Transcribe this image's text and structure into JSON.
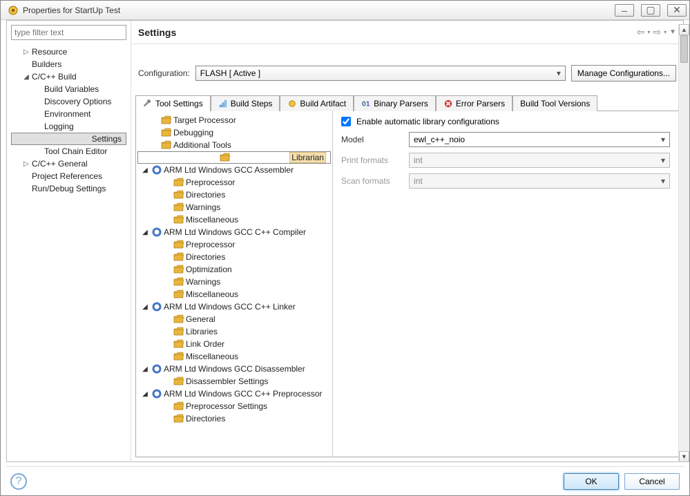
{
  "window": {
    "title": "Properties for StartUp Test"
  },
  "filter": {
    "placeholder": "type filter text"
  },
  "nav": {
    "items": [
      {
        "label": "Resource",
        "tw": "▷",
        "depth": 1
      },
      {
        "label": "Builders",
        "tw": "",
        "depth": 1
      },
      {
        "label": "C/C++ Build",
        "tw": "◢",
        "depth": 1
      },
      {
        "label": "Build Variables",
        "tw": "",
        "depth": 2
      },
      {
        "label": "Discovery Options",
        "tw": "",
        "depth": 2
      },
      {
        "label": "Environment",
        "tw": "",
        "depth": 2
      },
      {
        "label": "Logging",
        "tw": "",
        "depth": 2
      },
      {
        "label": "Settings",
        "tw": "",
        "depth": 2,
        "selected": true
      },
      {
        "label": "Tool Chain Editor",
        "tw": "",
        "depth": 2
      },
      {
        "label": "C/C++ General",
        "tw": "▷",
        "depth": 1
      },
      {
        "label": "Project References",
        "tw": "",
        "depth": 1
      },
      {
        "label": "Run/Debug Settings",
        "tw": "",
        "depth": 1
      }
    ]
  },
  "header": {
    "title": "Settings"
  },
  "config": {
    "label": "Configuration:",
    "value": "FLASH  [ Active ]",
    "manage": "Manage Configurations..."
  },
  "tabs": [
    {
      "label": "Tool Settings",
      "icon": "wrench"
    },
    {
      "label": "Build Steps",
      "icon": "steps"
    },
    {
      "label": "Build Artifact",
      "icon": "artifact"
    },
    {
      "label": "Binary Parsers",
      "icon": "binary"
    },
    {
      "label": "Error Parsers",
      "icon": "error"
    },
    {
      "label": "Build Tool Versions",
      "icon": ""
    }
  ],
  "tooltree": [
    {
      "label": "Target Processor",
      "tw": "",
      "icon": "folder",
      "depth": 1
    },
    {
      "label": "Debugging",
      "tw": "",
      "icon": "folder",
      "depth": 1
    },
    {
      "label": "Additional Tools",
      "tw": "",
      "icon": "folder",
      "depth": 1
    },
    {
      "label": "Librarian",
      "tw": "",
      "icon": "folder",
      "depth": 1,
      "selected": true
    },
    {
      "label": "ARM Ltd Windows GCC Assembler",
      "tw": "◢",
      "icon": "gear",
      "depth": 0
    },
    {
      "label": "Preprocessor",
      "tw": "",
      "icon": "folder",
      "depth": 2
    },
    {
      "label": "Directories",
      "tw": "",
      "icon": "folder",
      "depth": 2
    },
    {
      "label": "Warnings",
      "tw": "",
      "icon": "folder",
      "depth": 2
    },
    {
      "label": "Miscellaneous",
      "tw": "",
      "icon": "folder",
      "depth": 2
    },
    {
      "label": "ARM Ltd Windows GCC C++ Compiler",
      "tw": "◢",
      "icon": "gear",
      "depth": 0
    },
    {
      "label": "Preprocessor",
      "tw": "",
      "icon": "folder",
      "depth": 2
    },
    {
      "label": "Directories",
      "tw": "",
      "icon": "folder",
      "depth": 2
    },
    {
      "label": "Optimization",
      "tw": "",
      "icon": "folder",
      "depth": 2
    },
    {
      "label": "Warnings",
      "tw": "",
      "icon": "folder",
      "depth": 2
    },
    {
      "label": "Miscellaneous",
      "tw": "",
      "icon": "folder",
      "depth": 2
    },
    {
      "label": "ARM Ltd Windows GCC C++ Linker",
      "tw": "◢",
      "icon": "gear",
      "depth": 0
    },
    {
      "label": "General",
      "tw": "",
      "icon": "folder",
      "depth": 2
    },
    {
      "label": "Libraries",
      "tw": "",
      "icon": "folder",
      "depth": 2
    },
    {
      "label": "Link Order",
      "tw": "",
      "icon": "folder",
      "depth": 2
    },
    {
      "label": "Miscellaneous",
      "tw": "",
      "icon": "folder",
      "depth": 2
    },
    {
      "label": "ARM Ltd Windows GCC Disassembler",
      "tw": "◢",
      "icon": "gear",
      "depth": 0
    },
    {
      "label": "Disassembler Settings",
      "tw": "",
      "icon": "folder",
      "depth": 2
    },
    {
      "label": "ARM Ltd Windows GCC C++ Preprocessor",
      "tw": "◢",
      "icon": "gear",
      "depth": 0
    },
    {
      "label": "Preprocessor Settings",
      "tw": "",
      "icon": "folder",
      "depth": 2
    },
    {
      "label": "Directories",
      "tw": "",
      "icon": "folder",
      "depth": 2
    }
  ],
  "panel": {
    "enable": {
      "label": "Enable automatic library configurations",
      "checked": true
    },
    "model": {
      "label": "Model",
      "value": "ewl_c++_noio"
    },
    "print": {
      "label": "Print formats",
      "value": "int"
    },
    "scan": {
      "label": "Scan formats",
      "value": "int"
    }
  },
  "footer": {
    "ok": "OK",
    "cancel": "Cancel"
  }
}
